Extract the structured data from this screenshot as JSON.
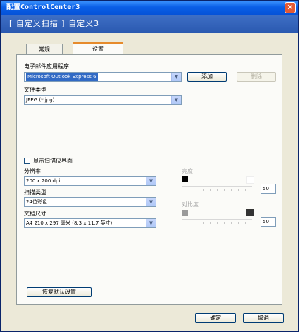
{
  "window": {
    "title": "配置ControlCenter3",
    "close_glyph": "✕"
  },
  "header": {
    "breadcrumb": "[ 自定义扫描 ] 自定义3"
  },
  "tabs": [
    {
      "label": "常规",
      "active": false
    },
    {
      "label": "设置",
      "active": true
    }
  ],
  "email_app": {
    "label": "电子邮件应用程序",
    "value": "Microsoft Outlook Express 6",
    "add_label": "添加",
    "delete_label": "删除"
  },
  "file_type": {
    "label": "文件类型",
    "value": "JPEG (*.jpg)"
  },
  "scan_ui_checkbox": {
    "label": "显示扫描仪界面",
    "checked": false
  },
  "resolution": {
    "label": "分辨率",
    "value": "200 x 200 dpi"
  },
  "scan_type": {
    "label": "扫描类型",
    "value": "24位彩色"
  },
  "document_size": {
    "label": "文档尺寸",
    "value": "A4 210 x 297 毫米 (8.3 x 11.7 英寸)"
  },
  "brightness": {
    "label": "亮度",
    "value": "50"
  },
  "contrast": {
    "label": "对比度",
    "value": "50"
  },
  "restore_defaults_label": "恢复默认设置",
  "footer": {
    "ok_label": "确定",
    "cancel_label": "取消"
  },
  "colors": {
    "titlebar": "#0a5fe6",
    "header_band": "#2a59b0",
    "dialog_bg": "#ece9d8",
    "selection": "#316ac5"
  }
}
